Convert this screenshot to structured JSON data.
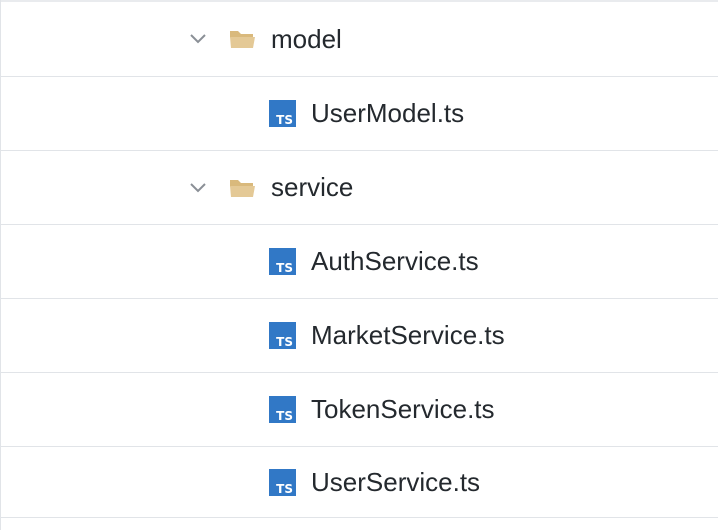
{
  "file_tree": {
    "items": [
      {
        "type": "folder",
        "name": "model",
        "expanded": true,
        "icon": "folder-open-icon"
      },
      {
        "type": "file",
        "name": "UserModel.ts",
        "icon": "typescript-file-icon",
        "badge": "TS"
      },
      {
        "type": "folder",
        "name": "service",
        "expanded": true,
        "icon": "folder-open-icon"
      },
      {
        "type": "file",
        "name": "AuthService.ts",
        "icon": "typescript-file-icon",
        "badge": "TS"
      },
      {
        "type": "file",
        "name": "MarketService.ts",
        "icon": "typescript-file-icon",
        "badge": "TS"
      },
      {
        "type": "file",
        "name": "TokenService.ts",
        "icon": "typescript-file-icon",
        "badge": "TS"
      },
      {
        "type": "file",
        "name": "UserService.ts",
        "icon": "typescript-file-icon",
        "badge": "TS"
      }
    ]
  },
  "colors": {
    "ts_badge_bg": "#3178c6",
    "folder_fill": "#e4c996",
    "row_border": "#e1e4e8",
    "text": "#24292e",
    "chevron": "#8a8f96"
  }
}
